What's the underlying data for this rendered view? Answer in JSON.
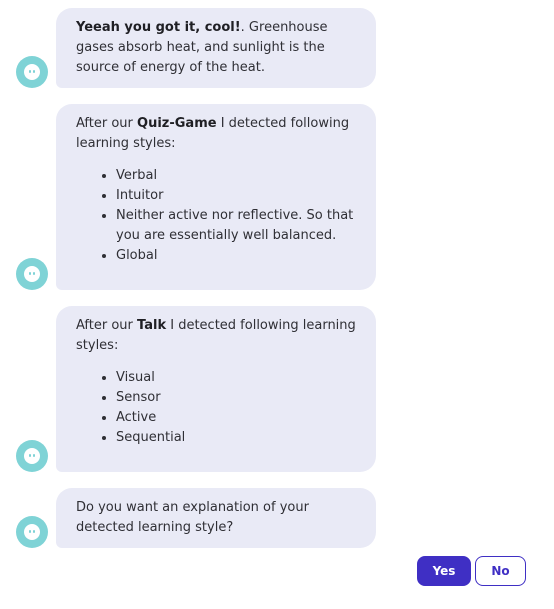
{
  "colors": {
    "bubble_bg": "#e9eaf6",
    "avatar": "#7fd3d6",
    "accent": "#3f2fc4",
    "text": "#2f2f35"
  },
  "avatar_icon": "robot-face-icon",
  "messages": [
    {
      "bold": "Yeeah you got it, cool!",
      "text": ". Greenhouse gases absorb heat, and sunlight is the source of energy of the heat."
    },
    {
      "prefix": "After our ",
      "bold": "Quiz-Game",
      "suffix": " I detected following learning styles:",
      "items": [
        "Verbal",
        "Intuitor",
        "Neither active nor reflective. So that you are essentially well balanced.",
        "Global"
      ]
    },
    {
      "prefix": "After our ",
      "bold": "Talk",
      "suffix": " I detected following learning styles:",
      "items": [
        "Visual",
        "Sensor",
        "Active",
        "Sequential"
      ]
    },
    {
      "text": "Do you want an explanation of your detected learning style?"
    }
  ],
  "buttons": {
    "yes": "Yes",
    "no": "No"
  }
}
